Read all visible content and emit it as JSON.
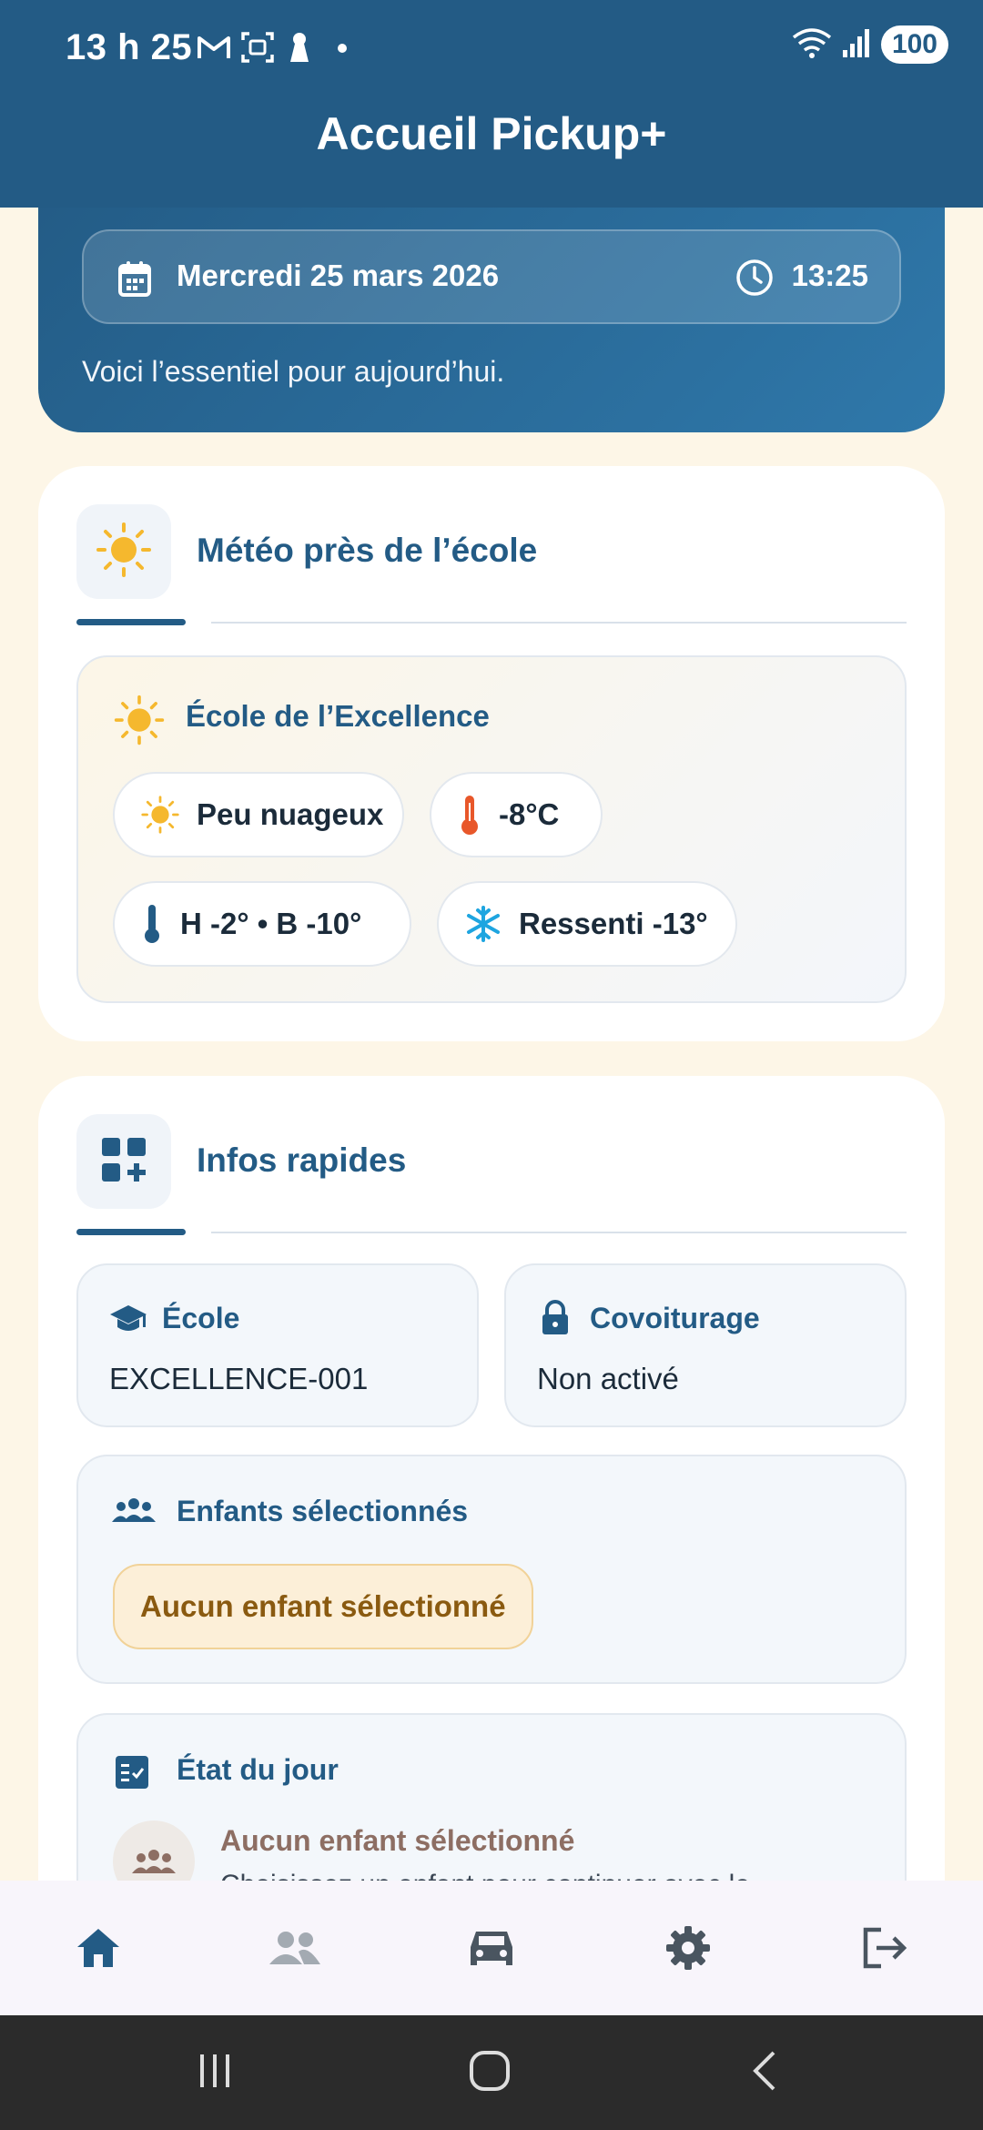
{
  "status_bar": {
    "time": "13 h 25",
    "battery": "100",
    "icons": [
      "gmail-icon",
      "screenshot-icon",
      "keyhole-icon",
      "dot-icon",
      "wifi-icon",
      "signal-icon"
    ]
  },
  "app_bar": {
    "title": "Accueil Pickup+"
  },
  "hero": {
    "date": "Mercredi 25 mars 2026",
    "time": "13:25",
    "subtitle": "Voici l’essentiel pour aujourd’hui."
  },
  "weather_card": {
    "title": "Météo près de l’école",
    "school_name": "École de l’Excellence",
    "condition": "Peu nuageux",
    "temperature": "-8°C",
    "high_low": "H -2° • B -10°",
    "feels_like": "Ressenti -13°"
  },
  "quick_info_card": {
    "title": "Infos rapides",
    "school_label": "École",
    "school_value": "EXCELLENCE-001",
    "carpool_label": "Covoiturage",
    "carpool_value": "Non activé",
    "children_label": "Enfants sélectionnés",
    "children_value": "Aucun enfant sélectionné",
    "day_status_label": "État du jour",
    "day_status_title": "Aucun enfant sélectionné",
    "day_status_text": "Choisissez un enfant pour continuer avec le"
  },
  "bottom_nav": [
    "home-icon",
    "people-icon",
    "car-icon",
    "gear-icon",
    "logout-icon"
  ],
  "colors": {
    "primary": "#235B85",
    "background": "#FDF6E7",
    "sun": "#F5B82E",
    "thermo_hot": "#E8572A",
    "snow": "#1EA5E0",
    "warning_text": "#8A5A10",
    "status_accent": "#8D6E63"
  }
}
